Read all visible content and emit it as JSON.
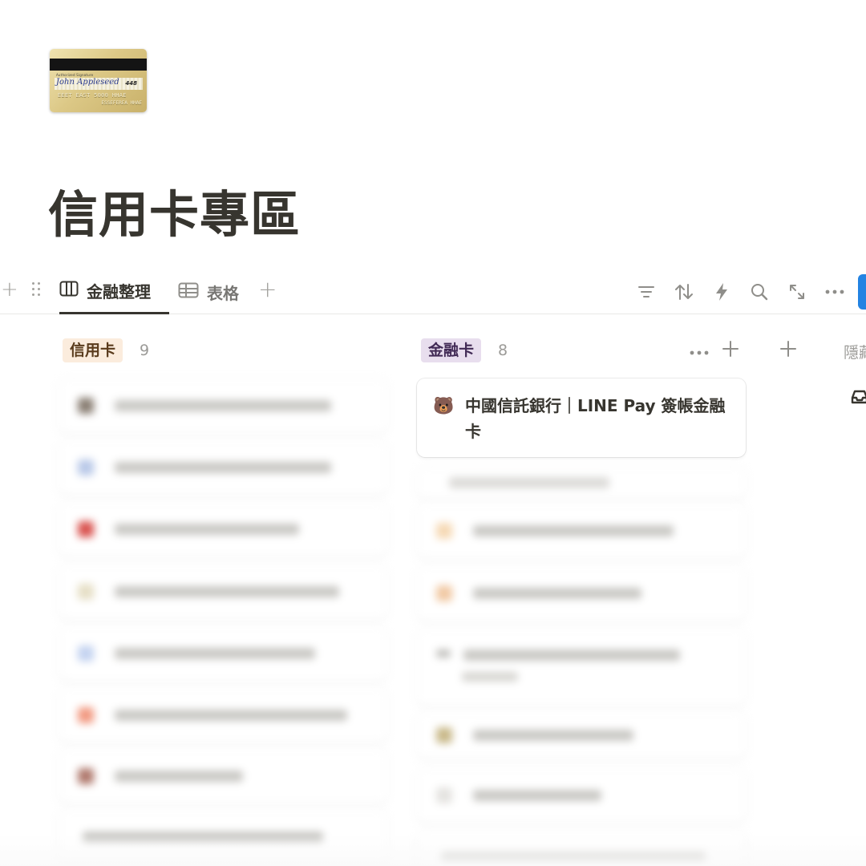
{
  "page": {
    "title": "信用卡專區",
    "icon": "credit-card-icon"
  },
  "viewbar": {
    "tabs": [
      {
        "label": "金融整理",
        "icon": "board-view-icon",
        "active": true
      },
      {
        "label": "表格",
        "icon": "table-view-icon",
        "active": false
      }
    ],
    "tools": [
      "filter-icon",
      "sort-icon",
      "automation-icon",
      "search-icon",
      "expand-icon",
      "more-icon"
    ],
    "accent": "#2383e2"
  },
  "board": {
    "groups": [
      {
        "label": "信用卡",
        "count": "9",
        "color": "#fbecdd"
      },
      {
        "label": "金融卡",
        "count": "8",
        "color": "#e8deee"
      }
    ],
    "hidden_label": "隱藏",
    "visible_card": {
      "emoji": "🐻",
      "title": "中國信託銀行｜LINE Pay 簽帳金融卡"
    }
  }
}
